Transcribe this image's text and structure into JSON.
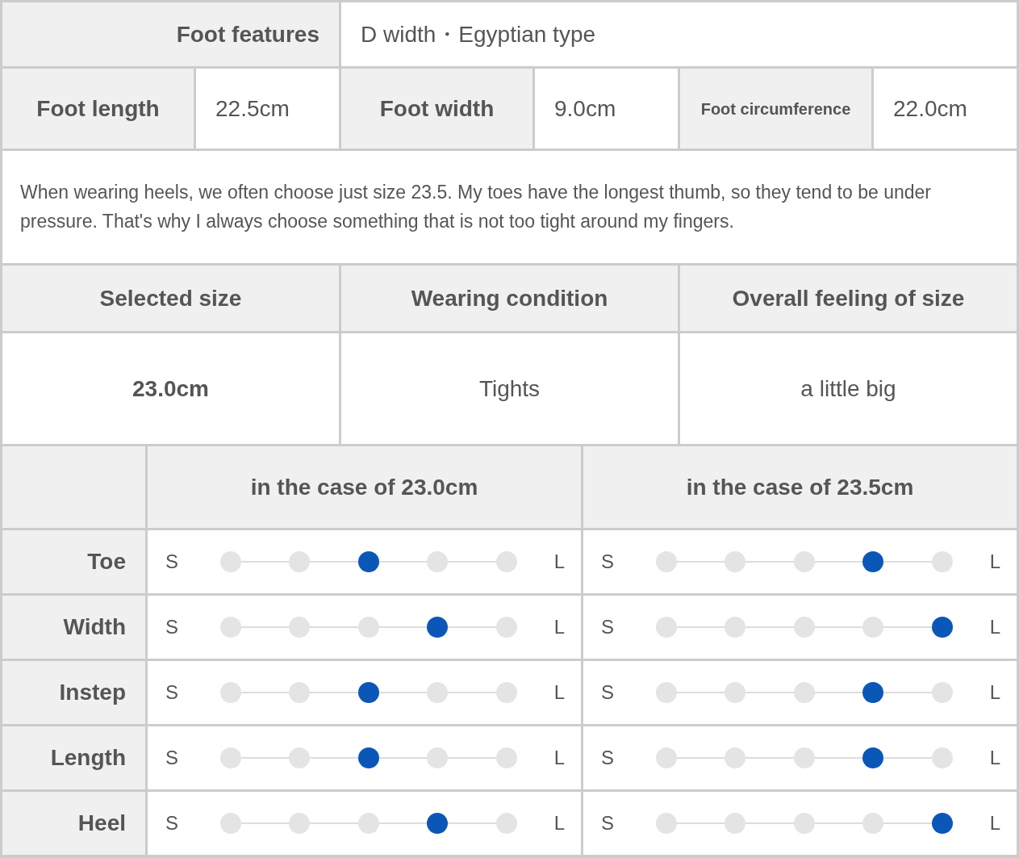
{
  "foot_features": {
    "label": "Foot features",
    "value": "D width・Egyptian type"
  },
  "measurements": [
    {
      "label": "Foot length",
      "value": "22.5cm"
    },
    {
      "label": "Foot width",
      "value": "9.0cm"
    },
    {
      "label": "Foot circumference",
      "value": "22.0cm"
    }
  ],
  "comment": "When wearing heels, we often choose just size 23.5. My toes have the longest thumb, so they tend to be under pressure. That's why I always choose something that is not too tight around my fingers.",
  "summary": {
    "columns": [
      "Selected size",
      "Wearing condition",
      "Overall feeling of size"
    ],
    "values": [
      "23.0cm",
      "Tights",
      "a little big"
    ]
  },
  "fit_table": {
    "columns": [
      "in the case of 23.0cm",
      "in the case of 23.5cm"
    ],
    "rows": [
      {
        "label": "Toe",
        "scales": [
          {
            "min": "S",
            "max": "L",
            "level": 0.5
          },
          {
            "min": "S",
            "max": "L",
            "level": 0.75
          }
        ]
      },
      {
        "label": "Width",
        "scales": [
          {
            "min": "S",
            "max": "L",
            "level": 0.75
          },
          {
            "min": "S",
            "max": "L",
            "level": 1
          }
        ]
      },
      {
        "label": "Instep",
        "scales": [
          {
            "min": "S",
            "max": "L",
            "level": 0.5
          },
          {
            "min": "S",
            "max": "L",
            "level": 0.75
          }
        ]
      },
      {
        "label": "Length",
        "scales": [
          {
            "min": "S",
            "max": "L",
            "level": 0.5
          },
          {
            "min": "S",
            "max": "L",
            "level": 0.75
          }
        ]
      },
      {
        "label": "Heel",
        "scales": [
          {
            "min": "S",
            "max": "L",
            "level": 0.75
          },
          {
            "min": "S",
            "max": "L",
            "level": 1
          }
        ]
      }
    ]
  }
}
